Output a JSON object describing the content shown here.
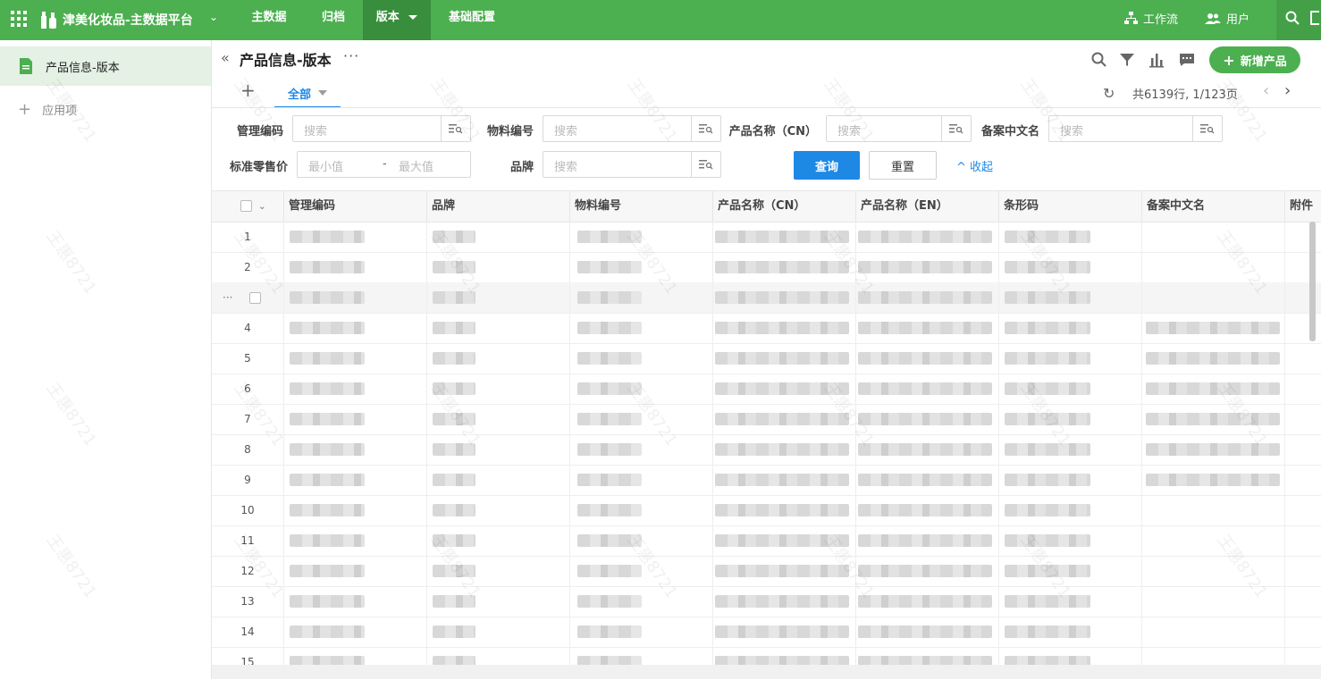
{
  "topbar": {
    "app_name": "津美化妆品-主数据平台",
    "nav": [
      "主数据",
      "归档",
      "版本",
      "基础配置"
    ],
    "active_nav": "版本",
    "workflow": "工作流",
    "users": "用户",
    "color": "#4caf50"
  },
  "sidebar": {
    "items": [
      {
        "label": "产品信息-版本",
        "icon": "document-icon"
      }
    ],
    "add_label": "应用项"
  },
  "header": {
    "title": "产品信息-版本",
    "add_button": "新增产品",
    "tab_all": "全部",
    "count_text": "共6139行, 1/123页"
  },
  "filters": {
    "fields": [
      {
        "label": "管理编码",
        "placeholder": "搜索"
      },
      {
        "label": "物料编号",
        "placeholder": "搜索"
      },
      {
        "label": "产品名称（CN）",
        "placeholder": "搜索"
      },
      {
        "label": "备案中文名",
        "placeholder": "搜索"
      },
      {
        "label": "品牌",
        "placeholder": "搜索"
      }
    ],
    "price_label": "标准零售价",
    "min_placeholder": "最小值",
    "max_placeholder": "最大值",
    "range_dash": "-",
    "query": "查询",
    "reset": "重置",
    "collapse": "收起"
  },
  "table": {
    "columns": [
      "管理编码",
      "品牌",
      "物料编号",
      "产品名称（CN）",
      "产品名称（EN）",
      "条形码",
      "备案中文名",
      "附件"
    ],
    "rows": [
      "1",
      "2",
      "3",
      "4",
      "5",
      "6",
      "7",
      "8",
      "9",
      "10",
      "11",
      "12",
      "13",
      "14",
      "15"
    ],
    "hover_row": "3"
  },
  "watermark_text": "王惠8721"
}
